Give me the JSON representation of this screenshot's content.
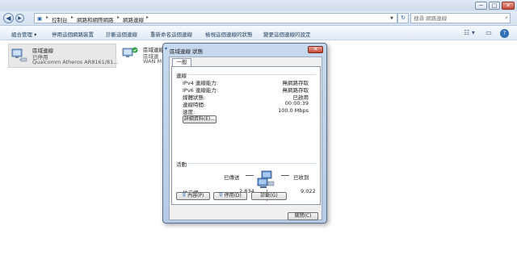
{
  "window": {
    "minimize_glyph": "─",
    "maximize_glyph": "□",
    "close_glyph": "✕"
  },
  "address": {
    "back_glyph": "◀",
    "forward_glyph": "▶",
    "crumbs": [
      "控制台",
      "網路和網際網路",
      "網路連線"
    ],
    "separator": "▸",
    "refresh_glyph": "↻",
    "search_placeholder": "搜尋 網路連線",
    "search_icon_glyph": "⌕"
  },
  "commands": {
    "organize": "組合管理 ▾",
    "disable": "停用這個網路裝置",
    "diagnose": "診斷這個連線",
    "rename": "重新命名這個連線",
    "view_status": "檢視這個連線的狀態",
    "change_settings": "變更這個連線的設定",
    "view_glyph": "☷ ▾",
    "pane_glyph": "▭",
    "help_glyph": "?"
  },
  "adapters": [
    {
      "name": "區域連線",
      "status": "已停用",
      "device": "Qualcomm Atheros AR8161/81..."
    },
    {
      "name": "區域連線",
      "status": "區域連",
      "device": "WAN M"
    }
  ],
  "dialog": {
    "title": "區域連線 狀態",
    "close_glyph": "✕",
    "tab_general": "一般",
    "connection": {
      "heading": "連線",
      "rows": [
        {
          "label": "IPv4 連線能力:",
          "value": "無網路存取"
        },
        {
          "label": "IPv6 連線能力:",
          "value": "無網路存取"
        },
        {
          "label": "媒體狀態:",
          "value": "已啟用"
        },
        {
          "label": "連線時間:",
          "value": "00:00:39"
        },
        {
          "label": "速度:",
          "value": "100.0 Mbps"
        }
      ],
      "details_button": "詳細資料(E)..."
    },
    "activity": {
      "heading": "活動",
      "sent_label": "已傳送",
      "received_label": "已收到",
      "bytes_label": "位元組:",
      "bytes_sent": "2,834",
      "bytes_received": "9,022"
    },
    "buttons": {
      "properties": "內容(P)",
      "disable": "停用(D)",
      "diagnose": "診斷(G)",
      "close": "關閉(C)"
    }
  }
}
